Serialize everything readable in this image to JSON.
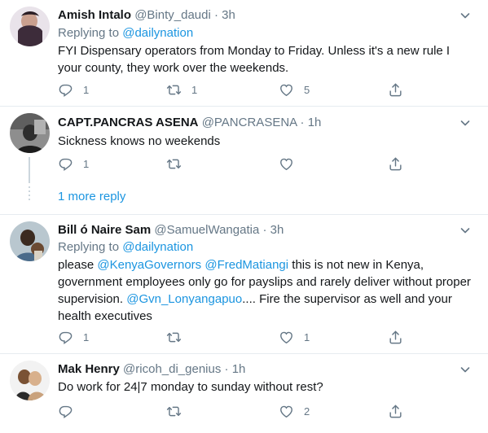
{
  "tweets": [
    {
      "name": "Amish Intalo",
      "handle": "@Binty_daudi",
      "dot": "·",
      "time": "3h",
      "replying_prefix": "Replying to",
      "replying_to": "@dailynation",
      "text": "FYI Dispensary operators from Monday to Friday. Unless it's a new rule I  your county, they work over the weekends.",
      "replies": "1",
      "retweets": "1",
      "likes": "5"
    },
    {
      "name": "CAPT.PANCRAS ASENA",
      "handle": "@PANCRASENA",
      "dot": "·",
      "time": "1h",
      "text": "Sickness knows no weekends",
      "replies": "1",
      "retweets": "",
      "likes": ""
    },
    {
      "name": "Bill ó Naire Sam",
      "handle": "@SamuelWangatia",
      "dot": "·",
      "time": "3h",
      "replying_prefix": "Replying to",
      "replying_to": "@dailynation",
      "text_parts": {
        "p1": "please ",
        "m1": "@KenyaGovernors",
        "p2": " ",
        "m2": "@FredMatiangi",
        "p3": "  this is not new in Kenya, government employees only go for payslips and rarely deliver without proper supervision. ",
        "m3": "@Gvn_Lonyangapuo",
        "p4": ".... Fire the supervisor as well and your health executives"
      },
      "replies": "1",
      "retweets": "",
      "likes": "1"
    },
    {
      "name": "Mak Henry",
      "handle": "@ricoh_di_genius",
      "dot": "·",
      "time": "1h",
      "text": "Do work for 24|7 monday to sunday without rest?",
      "replies": "",
      "retweets": "",
      "likes": "2"
    }
  ],
  "more_replies": "1 more reply",
  "icons": [
    "chevron-down-icon",
    "reply-icon",
    "retweet-icon",
    "like-icon",
    "share-icon"
  ],
  "colors": {
    "link": "#1b95e0",
    "muted": "#657786",
    "text": "#14171a",
    "border": "#e6ecf0"
  }
}
